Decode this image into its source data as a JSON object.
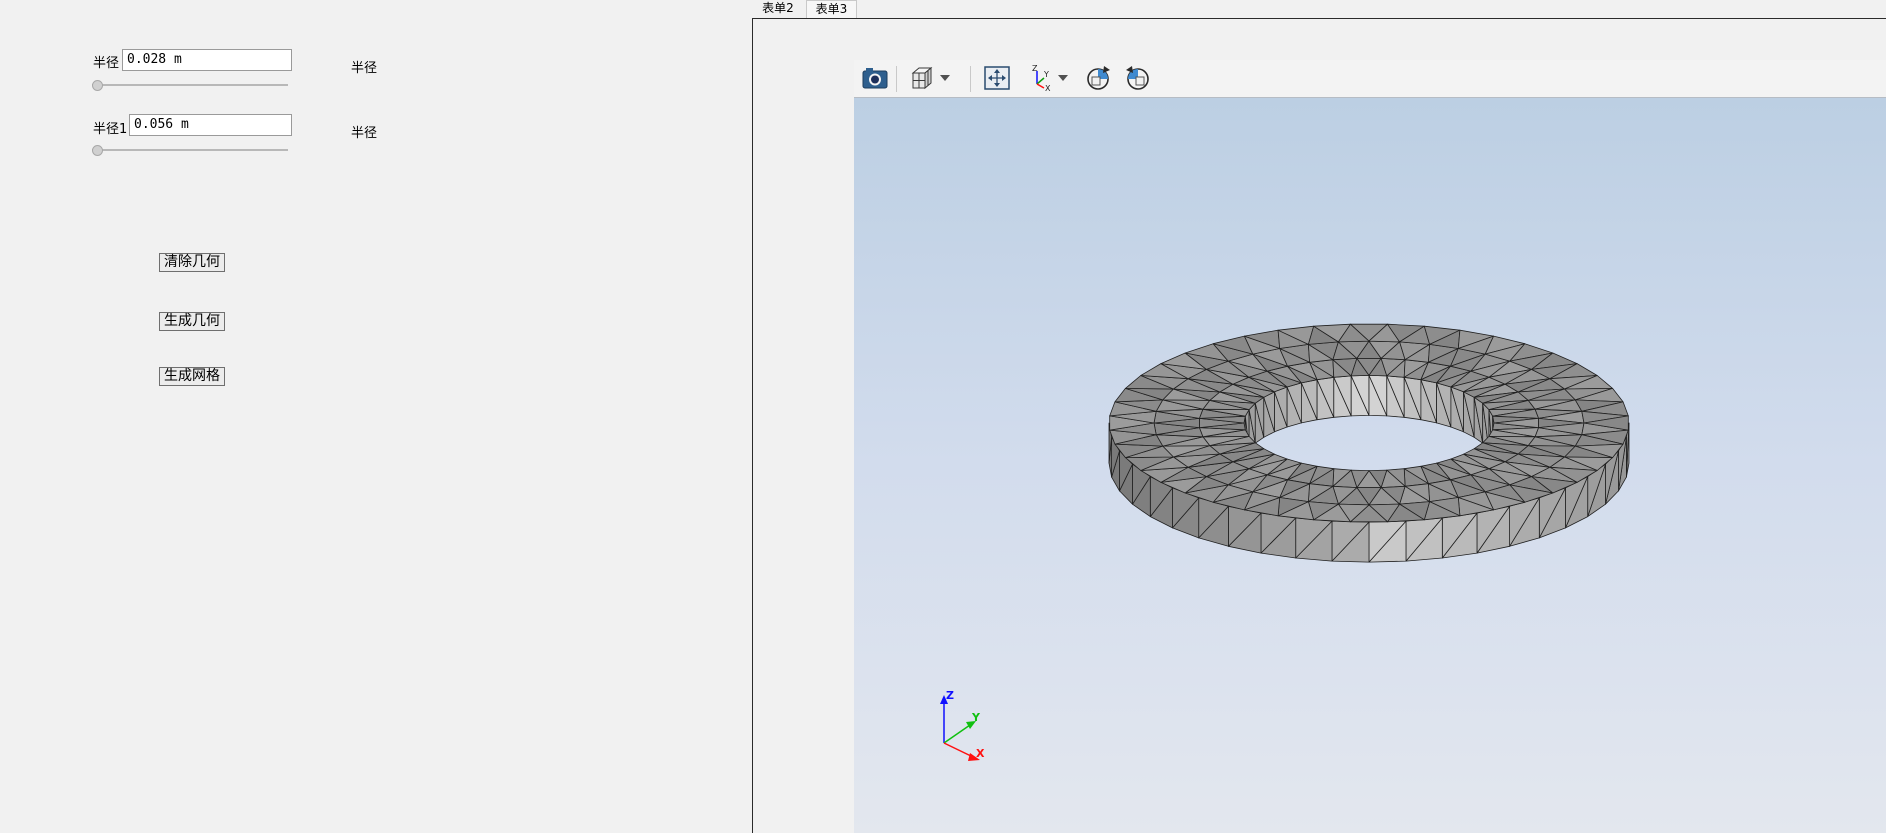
{
  "left_panel": {
    "param1": {
      "label": "半径",
      "value": "0.028 m",
      "side_label": "半径",
      "slider_value": 0
    },
    "param2": {
      "label": "半径1",
      "value": "0.056 m",
      "side_label": "半径",
      "slider_value": 0
    },
    "buttons": {
      "clear": "清除几何",
      "generate": "生成几何",
      "mesh": "生成网格"
    }
  },
  "tabs": [
    {
      "label": "表单2",
      "active": false
    },
    {
      "label": "表单3",
      "active": true
    }
  ],
  "toolbar": {
    "icons": [
      "camera-icon",
      "view-cube-icon",
      "dropdown-arrow-icon",
      "fit-view-icon",
      "axes-orientation-icon",
      "dropdown-arrow-icon",
      "rotate-clockwise-icon",
      "rotate-counterclockwise-icon"
    ]
  },
  "viewport": {
    "model": "meshed-annulus",
    "axis_triad": {
      "z": "Z",
      "y": "Y",
      "x": "X"
    },
    "colors": {
      "z": "#1010ff",
      "y": "#10c010",
      "x": "#ff1010",
      "mesh_face": "#8e8e8e",
      "mesh_edge": "#202020",
      "background_top": "#bccfe3",
      "background_bottom": "#e3e7ee"
    }
  }
}
